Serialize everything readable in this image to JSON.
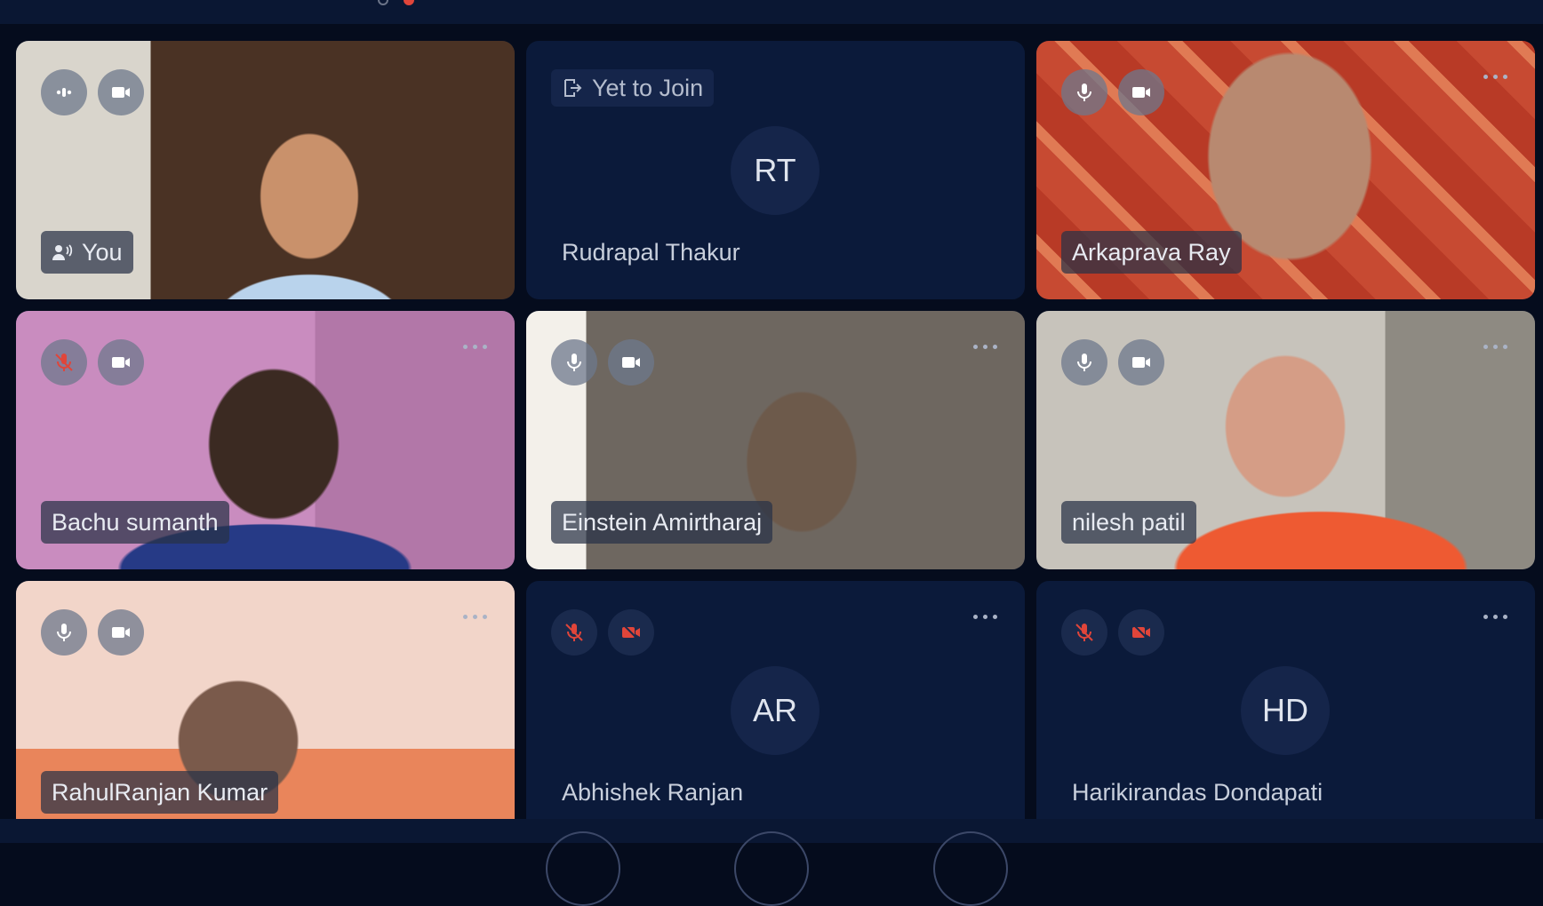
{
  "participants": [
    {
      "name": "You",
      "avatar": "",
      "status": "",
      "mic": "speaking-icon",
      "camera": "video-icon"
    },
    {
      "name": "Rudrapal Thakur",
      "avatar": "RT",
      "status": "Yet to Join"
    },
    {
      "name": "Arkaprava Ray",
      "avatar": "",
      "mic": "microphone-icon",
      "camera": "video-icon"
    },
    {
      "name": "Bachu sumanth",
      "avatar": "",
      "mic": "microphone-muted-icon",
      "camera": "video-icon"
    },
    {
      "name": "Einstein Amirtharaj",
      "avatar": "",
      "mic": "microphone-icon",
      "camera": "video-icon"
    },
    {
      "name": "nilesh patil",
      "avatar": "",
      "mic": "microphone-icon",
      "camera": "video-icon"
    },
    {
      "name": "RahulRanjan Kumar",
      "avatar": "",
      "mic": "microphone-icon",
      "camera": "video-icon"
    },
    {
      "name": "Abhishek Ranjan",
      "avatar": "AR",
      "mic": "microphone-muted-icon",
      "camera": "video-off-icon"
    },
    {
      "name": "Harikirandas Dondapati",
      "avatar": "HD",
      "mic": "microphone-muted-icon",
      "camera": "video-off-icon"
    }
  ],
  "colors": {
    "background": "#050c1d",
    "tile": "#0b1a3a",
    "muted": "#e0453a"
  }
}
